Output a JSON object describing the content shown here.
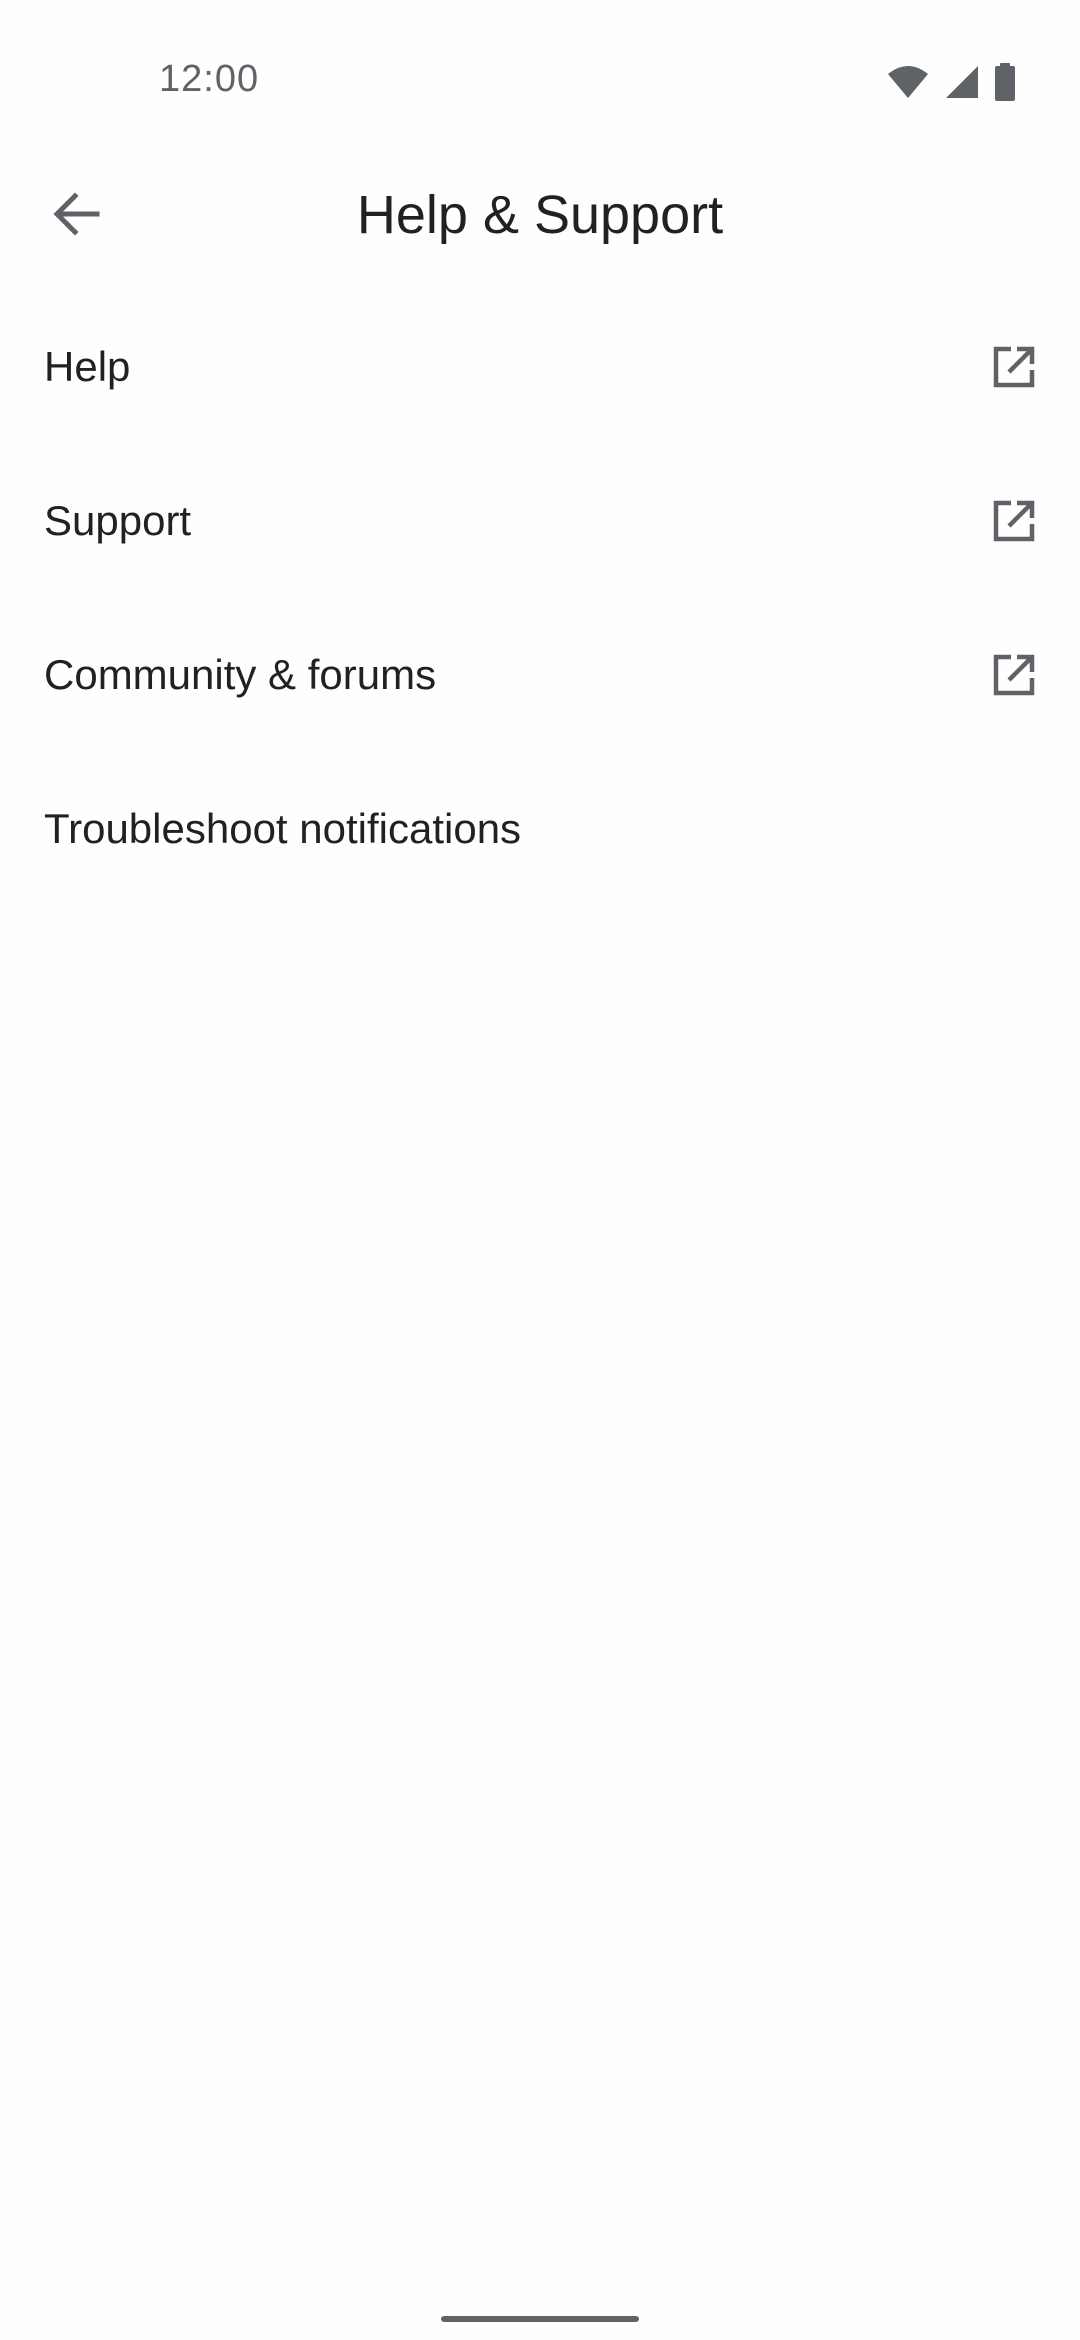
{
  "status_bar": {
    "time": "12:00",
    "icons": [
      "wifi-icon",
      "cell-signal-icon",
      "battery-icon"
    ]
  },
  "app_bar": {
    "title": "Help & Support",
    "back_icon": "arrow-back-icon"
  },
  "items": [
    {
      "label": "Help",
      "trailing_icon": "open-in-new-icon"
    },
    {
      "label": "Support",
      "trailing_icon": "open-in-new-icon"
    },
    {
      "label": "Community & forums",
      "trailing_icon": "open-in-new-icon"
    },
    {
      "label": "Troubleshoot notifications"
    }
  ],
  "colors": {
    "background": "#fefefe",
    "text_primary": "#202124",
    "text_secondary": "#5f6368",
    "icon": "#5f6368"
  }
}
